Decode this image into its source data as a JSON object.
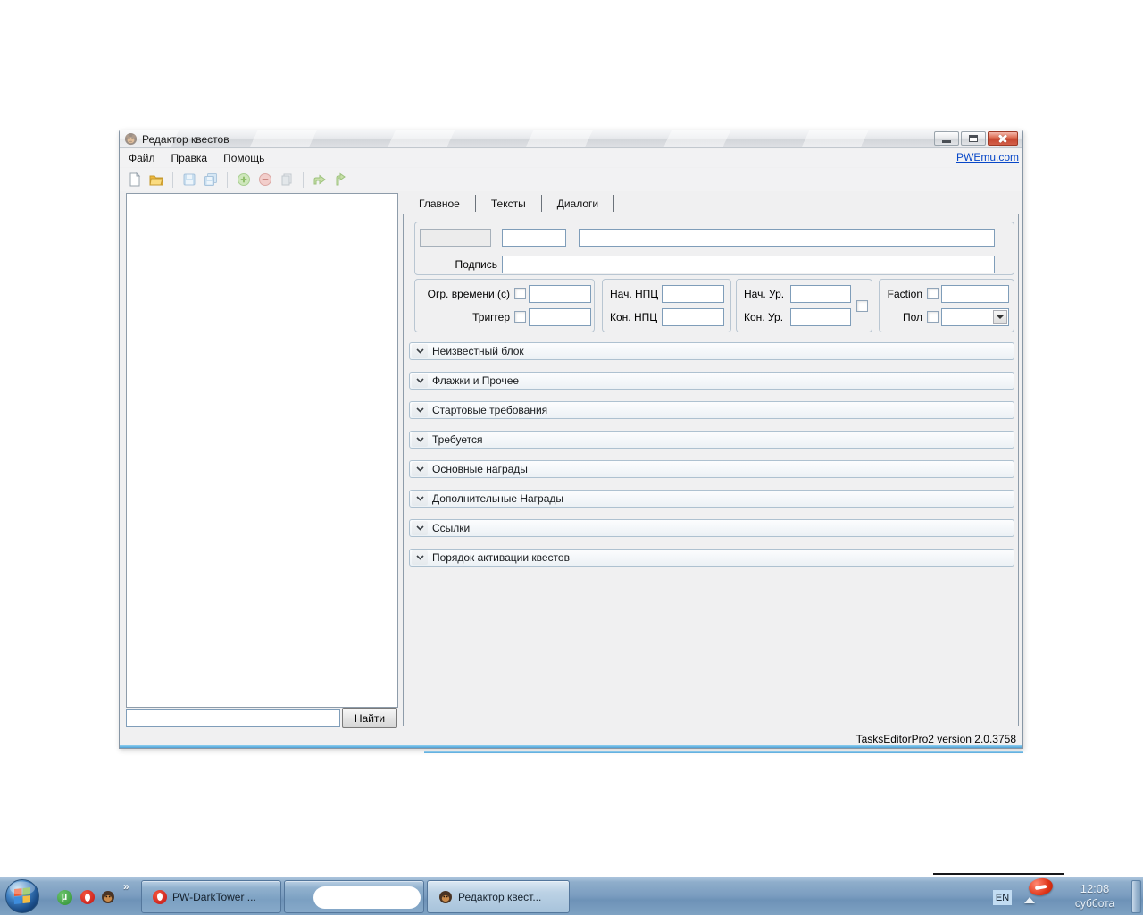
{
  "window": {
    "title": "Редактор квестов",
    "link": "PWEmu.com",
    "menu": [
      "Файл",
      "Правка",
      "Помощь"
    ],
    "window_control_icons": [
      "minimize-icon",
      "maximize-icon",
      "close-icon"
    ],
    "toolbar_icons": [
      "new-file-icon",
      "open-folder-icon",
      "save-icon",
      "save-all-icon",
      "add-icon",
      "remove-icon",
      "copy-icon",
      "branch-forward-icon",
      "branch-up-icon"
    ],
    "tabs": [
      "Главное",
      "Тексты",
      "Диалоги"
    ],
    "active_tab": "Главное",
    "form": {
      "signature_label": "Подпись",
      "time_limit_label": "Огр. времени (с)",
      "trigger_label": "Триггер",
      "start_npc_label": "Нач. НПЦ",
      "end_npc_label": "Кон. НПЦ",
      "start_level_label": "Нач. Ур.",
      "end_level_label": "Кон. Ур.",
      "faction_label": "Faction",
      "gender_label": "Пол"
    },
    "sections": [
      "Неизвестный блок",
      "Флажки и Прочее",
      "Стартовые требования",
      "Требуется",
      "Основные награды",
      "Дополнительные Награды",
      "Ссылки",
      "Порядок активации квестов"
    ],
    "search": {
      "value": "",
      "button": "Найти"
    },
    "status": "TasksEditorPro2 version 2.0.3758"
  },
  "taskbar": {
    "quick_launch_icons": [
      "utorrent-icon",
      "opera-icon",
      "quest-editor-icon"
    ],
    "overflow_chevron": "»",
    "buttons": [
      {
        "icon": "opera-icon",
        "label": "PW-DarkTower ...",
        "active": false
      },
      {
        "icon": "",
        "label": "",
        "active": false
      },
      {
        "icon": "quest-editor-icon",
        "label": "Редактор квест...",
        "active": true
      }
    ],
    "tray": {
      "language": "EN",
      "icons": [
        "hidden-icons-chevron",
        "red-badge-icon"
      ],
      "time": "12:08",
      "day": "суббота"
    }
  },
  "colors": {
    "taskbar_blue": "#7B9DC0",
    "link_blue": "#0747C8",
    "close_red": "#C74730",
    "window_bottom_blue": "#4CA0D6",
    "panel_bg": "#F0F0F1"
  }
}
